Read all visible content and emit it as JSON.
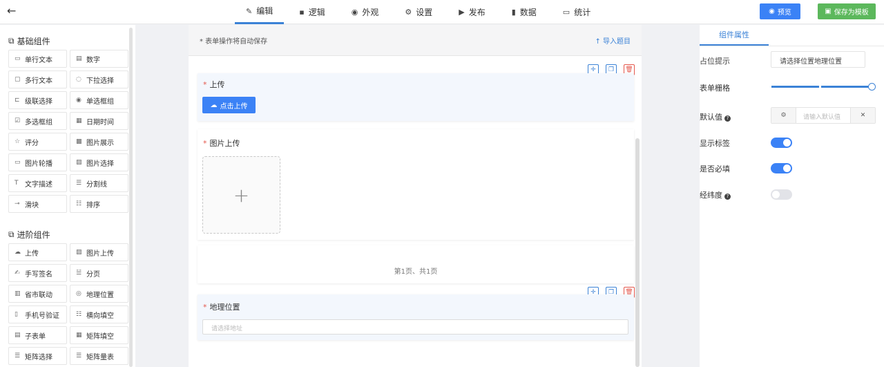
{
  "header": {
    "back_icon": "arrow-left-icon",
    "tabs": [
      {
        "label": "编辑",
        "icon": "✎"
      },
      {
        "label": "逻辑",
        "icon": "▪"
      },
      {
        "label": "外观",
        "icon": "◉"
      },
      {
        "label": "设置",
        "icon": "⚙"
      },
      {
        "label": "发布",
        "icon": "▶"
      },
      {
        "label": "数据",
        "icon": "▮"
      },
      {
        "label": "统计",
        "icon": "▭"
      }
    ],
    "preview_label": "预览",
    "save_template_label": "保存为模板",
    "colors": {
      "accent": "#3b82d6",
      "green": "#5cb85c"
    }
  },
  "sidebar": {
    "basic_title": "基础组件",
    "basic": [
      {
        "label": "单行文本",
        "icon": "▭"
      },
      {
        "label": "数字",
        "icon": "▤"
      },
      {
        "label": "多行文本",
        "icon": "▢"
      },
      {
        "label": "下拉选择",
        "icon": "◌"
      },
      {
        "label": "级联选择",
        "icon": "⊏"
      },
      {
        "label": "单选框组",
        "icon": "◉"
      },
      {
        "label": "多选框组",
        "icon": "☑"
      },
      {
        "label": "日期时间",
        "icon": "▦"
      },
      {
        "label": "评分",
        "icon": "☆"
      },
      {
        "label": "图片展示",
        "icon": "▩"
      },
      {
        "label": "图片轮播",
        "icon": "▭"
      },
      {
        "label": "图片选择",
        "icon": "▨"
      },
      {
        "label": "文字描述",
        "icon": "T"
      },
      {
        "label": "分割线",
        "icon": "☰"
      },
      {
        "label": "滑块",
        "icon": "⊸"
      },
      {
        "label": "排序",
        "icon": "☷"
      }
    ],
    "advanced_title": "进阶组件",
    "advanced": [
      {
        "label": "上传",
        "icon": "☁"
      },
      {
        "label": "图片上传",
        "icon": "▨"
      },
      {
        "label": "手写签名",
        "icon": "✍"
      },
      {
        "label": "分页",
        "icon": "☱"
      },
      {
        "label": "省市联动",
        "icon": "▥"
      },
      {
        "label": "地理位置",
        "icon": "◎"
      },
      {
        "label": "手机号验证",
        "icon": "▯"
      },
      {
        "label": "横向填空",
        "icon": "☷"
      },
      {
        "label": "子表单",
        "icon": "▤"
      },
      {
        "label": "矩阵填空",
        "icon": "▦"
      },
      {
        "label": "矩阵选择",
        "icon": "☰"
      },
      {
        "label": "矩阵量表",
        "icon": "☰"
      }
    ]
  },
  "form": {
    "autosave_note": "* 表单操作将自动保存",
    "import_label": "导入题目",
    "upload": {
      "label": "上传",
      "button": "点击上传"
    },
    "image_upload": {
      "label": "图片上传"
    },
    "pagination": {
      "text": "第1页、共1页"
    },
    "geo": {
      "label": "地理位置",
      "placeholder": "请选择地址"
    }
  },
  "props": {
    "tab": "组件属性",
    "placeholder_label": "占位提示",
    "placeholder_value": "请选择位置地理位置",
    "grid_label": "表单栅格",
    "grid_value_percent": 100,
    "default_label": "默认值",
    "default_placeholder": "请输入默认值",
    "show_label": "显示标签",
    "show_label_on": true,
    "required_label": "是否必填",
    "required_on": true,
    "latlng_label": "经纬度",
    "latlng_on": false
  }
}
